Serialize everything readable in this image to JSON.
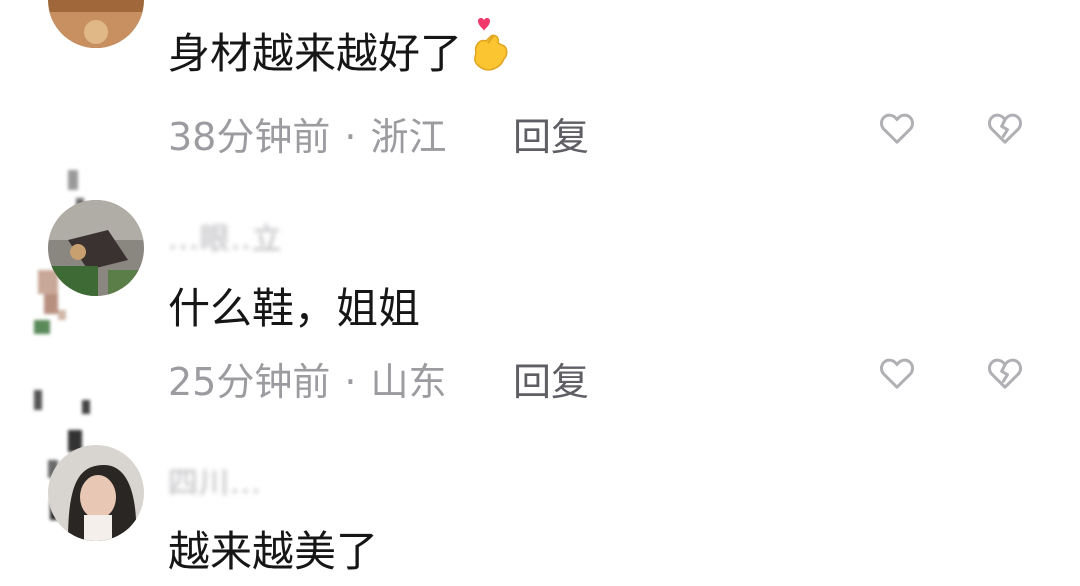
{
  "comments": [
    {
      "username": "",
      "text": "身材越来越好了",
      "emoji": "heart-hand-emoji",
      "time": "38分钟前",
      "dot": "·",
      "location": "浙江",
      "reply_label": "回复"
    },
    {
      "username": "...眼..立",
      "text": "什么鞋，姐姐",
      "time": "25分钟前",
      "dot": "·",
      "location": "山东",
      "reply_label": "回复"
    },
    {
      "username": "四川...",
      "text": "越来越美了",
      "time": "",
      "dot": "",
      "location": "",
      "reply_label": ""
    }
  ],
  "icons": {
    "like": "heart-outline-icon",
    "dislike": "broken-heart-icon"
  },
  "colors": {
    "text": "#161616",
    "meta": "#9b9ba0",
    "reply": "#5e5e64",
    "icon": "#b0b0b4"
  }
}
